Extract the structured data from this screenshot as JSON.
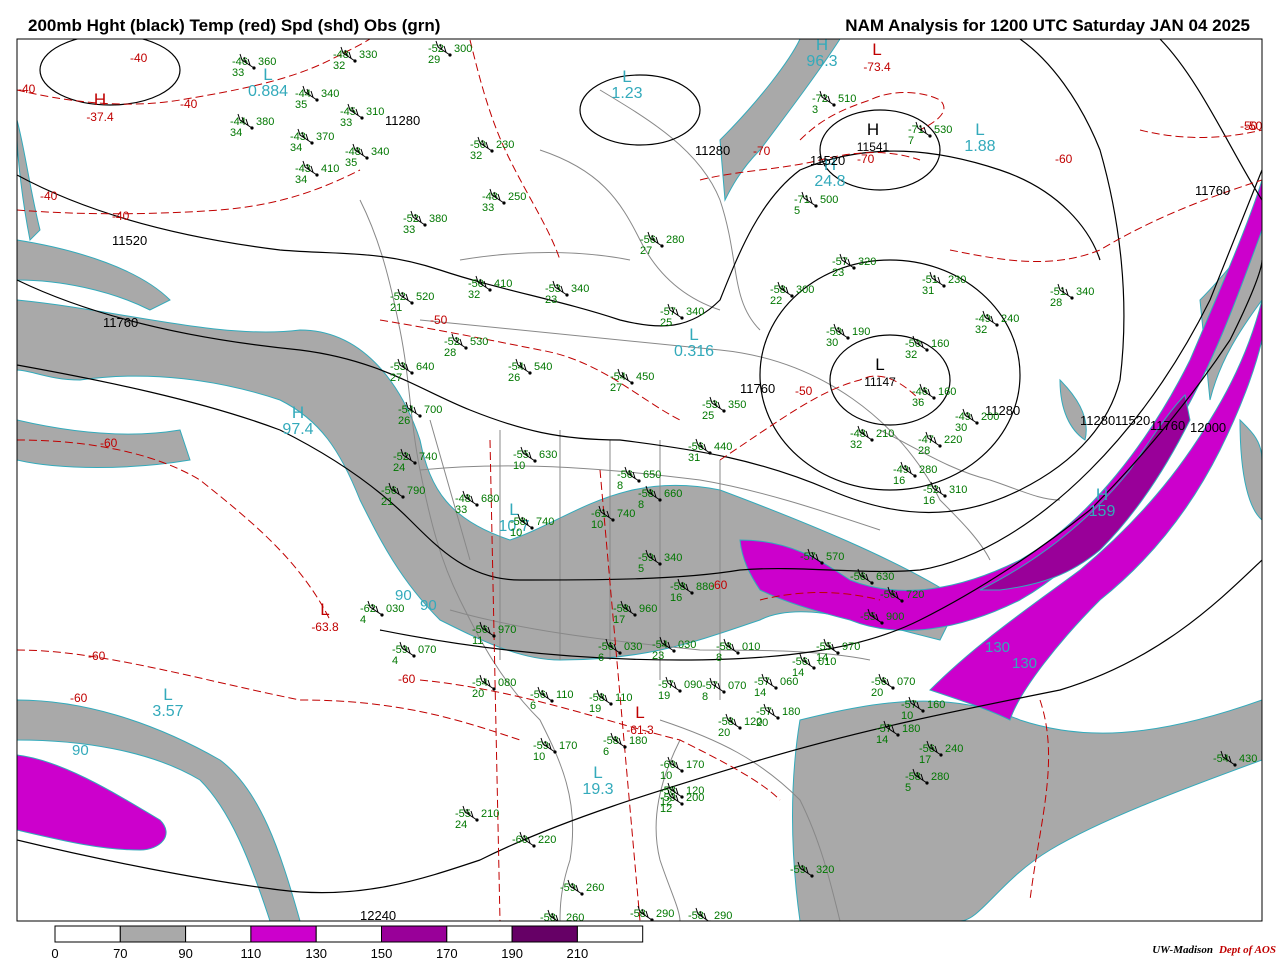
{
  "header": {
    "left_title": "200mb Hght (black) Temp (red) Spd (shd) Obs (grn)",
    "right_title": "NAM Analysis for 1200 UTC Saturday  JAN 04 2025"
  },
  "colors": {
    "height_contour": "#000000",
    "temperature_contour": "#c00000",
    "speed_70_90": "#a9a9a9",
    "speed_110_130": "#cc00cc",
    "speed_150_170": "#990099",
    "speed_190_210": "#660066",
    "obs_text": "#007700",
    "extrema_cyan": "#33aabb",
    "borders": "#888888"
  },
  "speed_legend": {
    "labels": [
      "0",
      "70",
      "90",
      "110",
      "130",
      "150",
      "170",
      "190",
      "210"
    ],
    "fills": [
      "#ffffff",
      "#a9a9a9",
      "#ffffff",
      "#cc00cc",
      "#ffffff",
      "#990099",
      "#ffffff",
      "#660066",
      "#ffffff"
    ]
  },
  "height_labels": [
    "11520",
    "11760",
    "11280",
    "11280",
    "11520",
    "11760",
    "11280",
    "11280",
    "11520",
    "11760",
    "12000",
    "11760",
    "12240"
  ],
  "temperature_labels": [
    "-40",
    "-40",
    "-40",
    "-40",
    "-40",
    "-50",
    "-50",
    "-50",
    "-60",
    "-60",
    "-60",
    "-60",
    "-60",
    "-60",
    "-60",
    "-70",
    "-70",
    "-50"
  ],
  "pressure_centers": [
    {
      "type": "H",
      "value": "-37.4",
      "kind": "temp"
    },
    {
      "type": "L",
      "value": "0.884",
      "kind": "speed"
    },
    {
      "type": "L",
      "value": "1.23",
      "kind": "speed"
    },
    {
      "type": "H",
      "value": "96.3",
      "kind": "speed"
    },
    {
      "type": "L",
      "value": "-73.4",
      "kind": "temp"
    },
    {
      "type": "H",
      "value": "11541",
      "kind": "height"
    },
    {
      "type": "L",
      "value": "1.88",
      "kind": "speed"
    },
    {
      "type": "H",
      "value": "24.8",
      "kind": "speed"
    },
    {
      "type": "L",
      "value": "0.316",
      "kind": "speed"
    },
    {
      "type": "L",
      "value": "11147",
      "kind": "height"
    },
    {
      "type": "H",
      "value": "97.4",
      "kind": "speed"
    },
    {
      "type": "L",
      "value": "10.7",
      "kind": "speed"
    },
    {
      "type": "H",
      "value": "159",
      "kind": "speed"
    },
    {
      "type": "L",
      "value": "-63.8",
      "kind": "temp"
    },
    {
      "type": "L",
      "value": "3.57",
      "kind": "speed"
    },
    {
      "type": "L",
      "value": "-61.3",
      "kind": "temp"
    },
    {
      "type": "L",
      "value": "19.3",
      "kind": "speed"
    }
  ],
  "speed_labels": [
    "90",
    "90",
    "90",
    "130",
    "130"
  ],
  "observations": [
    {
      "temp": "-46",
      "dew": "33",
      "hght": "360"
    },
    {
      "temp": "-44",
      "dew": "35",
      "hght": "340"
    },
    {
      "temp": "-44",
      "dew": "34",
      "hght": "380"
    },
    {
      "temp": "-43",
      "dew": "34",
      "hght": "370"
    },
    {
      "temp": "-45",
      "dew": "33",
      "hght": "310"
    },
    {
      "temp": "-48",
      "dew": "32",
      "hght": "330"
    },
    {
      "temp": "-52",
      "dew": "29",
      "hght": "300"
    },
    {
      "temp": "-48",
      "dew": "35",
      "hght": "340"
    },
    {
      "temp": "-43",
      "dew": "34",
      "hght": "410"
    },
    {
      "temp": "-50",
      "dew": "32",
      "hght": "230"
    },
    {
      "temp": "-48",
      "dew": "33",
      "hght": "250"
    },
    {
      "temp": "-52",
      "dew": "33",
      "hght": "380"
    },
    {
      "temp": "-56",
      "dew": "27",
      "hght": "280"
    },
    {
      "temp": "-50",
      "dew": "32",
      "hght": "410"
    },
    {
      "temp": "-53",
      "dew": "23",
      "hght": "340"
    },
    {
      "temp": "-52",
      "dew": "21",
      "hght": "520"
    },
    {
      "temp": "-52",
      "dew": "28",
      "hght": "530"
    },
    {
      "temp": "-57",
      "dew": "25",
      "hght": "340"
    },
    {
      "temp": "-58",
      "dew": "22",
      "hght": "300"
    },
    {
      "temp": "-57",
      "dew": "23",
      "hght": "320"
    },
    {
      "temp": "-72",
      "dew": "3",
      "hght": "510"
    },
    {
      "temp": "-71",
      "dew": "5",
      "hght": "500"
    },
    {
      "temp": "-71",
      "dew": "7",
      "hght": "530"
    },
    {
      "temp": "-51",
      "dew": "31",
      "hght": "230"
    },
    {
      "temp": "-51",
      "dew": "28",
      "hght": "340"
    },
    {
      "temp": "-49",
      "dew": "32",
      "hght": "240"
    },
    {
      "temp": "-50",
      "dew": "30",
      "hght": "190"
    },
    {
      "temp": "-50",
      "dew": "32",
      "hght": "160"
    },
    {
      "temp": "-46",
      "dew": "36",
      "hght": "160"
    },
    {
      "temp": "-49",
      "dew": "30",
      "hght": "200"
    },
    {
      "temp": "-48",
      "dew": "32",
      "hght": "210"
    },
    {
      "temp": "-47",
      "dew": "28",
      "hght": "220"
    },
    {
      "temp": "-53",
      "dew": "27",
      "hght": "640"
    },
    {
      "temp": "-54",
      "dew": "26",
      "hght": "700"
    },
    {
      "temp": "-52",
      "dew": "24",
      "hght": "740"
    },
    {
      "temp": "-56",
      "dew": "21",
      "hght": "790"
    },
    {
      "temp": "-54",
      "dew": "26",
      "hght": "540"
    },
    {
      "temp": "-54",
      "dew": "27",
      "hght": "450"
    },
    {
      "temp": "-53",
      "dew": "25",
      "hght": "350"
    },
    {
      "temp": "-56",
      "dew": "31",
      "hght": "440"
    },
    {
      "temp": "-55",
      "dew": "10",
      "hght": "630"
    },
    {
      "temp": "-48",
      "dew": "33",
      "hght": "680"
    },
    {
      "temp": "-58",
      "dew": "10",
      "hght": "740"
    },
    {
      "temp": "-61",
      "dew": "10",
      "hght": "740"
    },
    {
      "temp": "-56",
      "dew": "8",
      "hght": "650"
    },
    {
      "temp": "-58",
      "dew": "8",
      "hght": "660"
    },
    {
      "temp": "-49",
      "dew": "16",
      "hght": "280"
    },
    {
      "temp": "-52",
      "dew": "16",
      "hght": "310"
    },
    {
      "temp": "-62",
      "dew": "4",
      "hght": "030"
    },
    {
      "temp": "-59",
      "dew": "4",
      "hght": "070"
    },
    {
      "temp": "-54",
      "dew": "20",
      "hght": "080"
    },
    {
      "temp": "-56",
      "dew": "6",
      "hght": "110"
    },
    {
      "temp": "-58",
      "dew": "19",
      "hght": "110"
    },
    {
      "temp": "-57",
      "dew": "19",
      "hght": "090"
    },
    {
      "temp": "-57",
      "dew": "8",
      "hght": "070"
    },
    {
      "temp": "-57",
      "dew": "14",
      "hght": "060"
    },
    {
      "temp": "-58",
      "dew": "8",
      "hght": "010"
    },
    {
      "temp": "-56",
      "dew": "6",
      "hght": "030"
    },
    {
      "temp": "-54",
      "dew": "23",
      "hght": "030"
    },
    {
      "temp": "-56",
      "dew": "14",
      "hght": "010"
    },
    {
      "temp": "-55",
      "dew": "14",
      "hght": "970"
    },
    {
      "temp": "-56",
      "dew": "11",
      "hght": "970"
    },
    {
      "temp": "-58",
      "dew": "17",
      "hght": "960"
    },
    {
      "temp": "-59",
      "dew": "5",
      "hght": "340"
    },
    {
      "temp": "-58",
      "dew": "16",
      "hght": "880"
    },
    {
      "temp": "-56",
      "dew": "20",
      "hght": "070"
    },
    {
      "temp": "-57",
      "dew": "10",
      "hght": "160"
    },
    {
      "temp": "-57",
      "dew": "14",
      "hght": "180"
    },
    {
      "temp": "-56",
      "dew": "17",
      "hght": "240"
    },
    {
      "temp": "-58",
      "dew": "5",
      "hght": "280"
    },
    {
      "temp": "-58",
      "dew": "12",
      "hght": "120"
    },
    {
      "temp": "-58",
      "dew": "20",
      "hght": "120"
    },
    {
      "temp": "-57",
      "dew": "20",
      "hght": "180"
    },
    {
      "temp": "-59",
      "dew": "10",
      "hght": "170"
    },
    {
      "temp": "-58",
      "dew": "6",
      "hght": "180"
    },
    {
      "temp": "-60",
      "dew": "10",
      "hght": "170"
    },
    {
      "temp": "-59",
      "dew": "12",
      "hght": "200"
    },
    {
      "temp": "-55",
      "dew": "24",
      "hght": "210"
    },
    {
      "temp": "-60",
      "dew": "",
      "hght": "220"
    },
    {
      "temp": "-59",
      "dew": "",
      "hght": "260"
    },
    {
      "temp": "-58",
      "dew": "",
      "hght": "260"
    },
    {
      "temp": "-58",
      "dew": "",
      "hght": "290"
    },
    {
      "temp": "-58",
      "dew": "",
      "hght": "290"
    },
    {
      "temp": "-59",
      "dew": "",
      "hght": "320"
    },
    {
      "temp": "-54",
      "dew": "",
      "hght": "430"
    },
    {
      "temp": "-57",
      "dew": "",
      "hght": "570"
    },
    {
      "temp": "-56",
      "dew": "",
      "hght": "630"
    },
    {
      "temp": "-56",
      "dew": "",
      "hght": "720"
    },
    {
      "temp": "-55",
      "dew": "",
      "hght": "900"
    }
  ],
  "credit": {
    "org": "UW-Madison",
    "dept": "Dept of AOS"
  }
}
